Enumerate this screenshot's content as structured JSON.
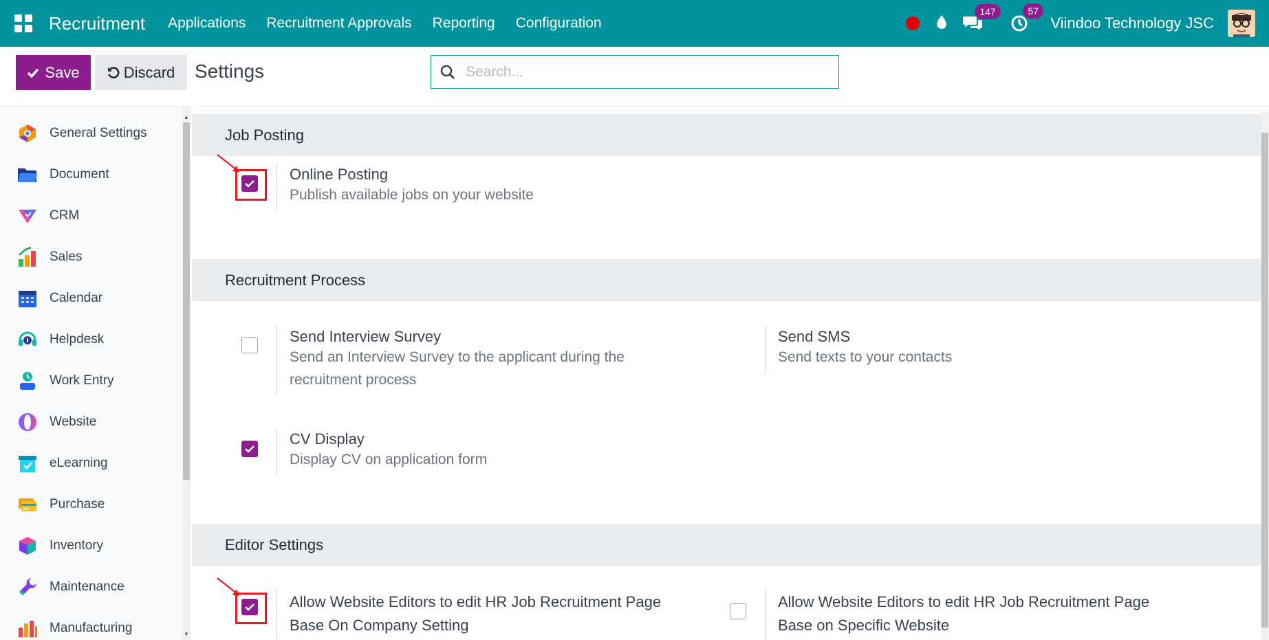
{
  "navbar": {
    "brand": "Recruitment",
    "menu": [
      "Applications",
      "Recruitment Approvals",
      "Reporting",
      "Configuration"
    ],
    "messages_count": "147",
    "activities_count": "57",
    "company": "Viindoo Technology JSC",
    "color": "#00939e"
  },
  "control_panel": {
    "save_label": "Save",
    "discard_label": "Discard",
    "title": "Settings",
    "search_placeholder": "Search..."
  },
  "sidebar": {
    "items": [
      {
        "label": "General Settings",
        "icon": "general-settings-icon"
      },
      {
        "label": "Document",
        "icon": "folder-icon"
      },
      {
        "label": "CRM",
        "icon": "crm-icon"
      },
      {
        "label": "Sales",
        "icon": "sales-chart-icon"
      },
      {
        "label": "Calendar",
        "icon": "calendar-icon"
      },
      {
        "label": "Helpdesk",
        "icon": "headset-icon"
      },
      {
        "label": "Work Entry",
        "icon": "work-entry-icon"
      },
      {
        "label": "Website",
        "icon": "website-icon"
      },
      {
        "label": "eLearning",
        "icon": "elearning-icon"
      },
      {
        "label": "Purchase",
        "icon": "purchase-card-icon"
      },
      {
        "label": "Inventory",
        "icon": "inventory-box-icon"
      },
      {
        "label": "Maintenance",
        "icon": "wrench-icon"
      },
      {
        "label": "Manufacturing",
        "icon": "factory-icon"
      }
    ]
  },
  "sections": {
    "job_posting": {
      "title": "Job Posting",
      "online_posting": {
        "title": "Online Posting",
        "desc": "Publish available jobs on your website",
        "checked": true
      }
    },
    "recruitment_process": {
      "title": "Recruitment Process",
      "interview_survey": {
        "title": "Send Interview Survey",
        "desc_line1": "Send an Interview Survey to the applicant during the",
        "desc_line2": "recruitment process",
        "checked": false
      },
      "send_sms": {
        "title": "Send SMS",
        "desc": "Send texts to your contacts"
      },
      "cv_display": {
        "title": "CV Display",
        "desc": "Display CV on application form",
        "checked": true
      }
    },
    "editor_settings": {
      "title": "Editor Settings",
      "company_setting": {
        "title_line1": "Allow Website Editors to edit HR Job Recruitment Page",
        "title_line2": "Base On Company Setting",
        "checked": true
      },
      "specific_website": {
        "title_line1": "Allow Website Editors to edit HR Job Recruitment Page",
        "title_line2": "Base on Specific Website",
        "checked": false
      }
    }
  },
  "colors": {
    "accent": "#8b1d8f",
    "highlight": "#e41b23"
  }
}
